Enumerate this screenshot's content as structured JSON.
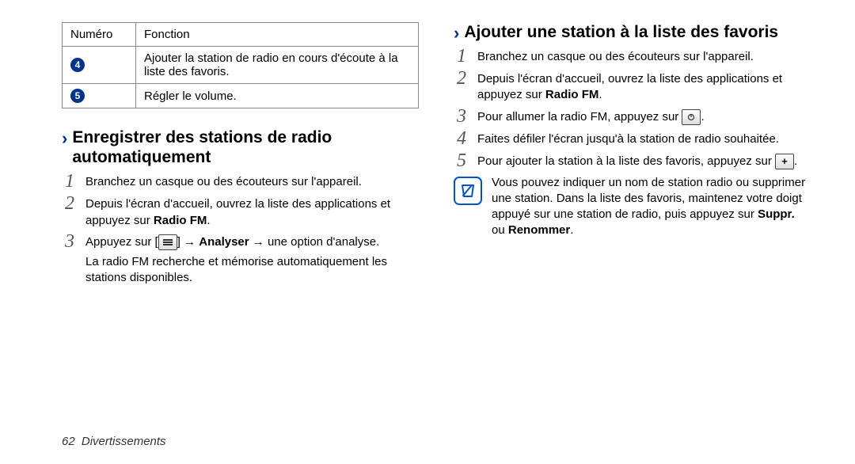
{
  "table": {
    "head_num": "Numéro",
    "head_fn": "Fonction",
    "rows": [
      {
        "n": "4",
        "fn": "Ajouter la station de radio en cours d'écoute à la liste des favoris."
      },
      {
        "n": "5",
        "fn": "Régler le volume."
      }
    ]
  },
  "left": {
    "title": "Enregistrer des stations de radio automatiquement",
    "steps": {
      "s1": "Branchez un casque ou des écouteurs sur l'appareil.",
      "s2_a": "Depuis l'écran d'accueil, ouvrez la liste des applications et appuyez sur ",
      "s2_b": "Radio FM",
      "s2_c": ".",
      "s3_a": "Appuyez sur [",
      "s3_b": "] → ",
      "s3_c": "Analyser",
      "s3_d": " → une option d'analyse.",
      "s3_sub": "La radio FM recherche et mémorise automatiquement les stations disponibles."
    }
  },
  "right": {
    "title": "Ajouter une station à la liste des favoris",
    "steps": {
      "s1": "Branchez un casque ou des écouteurs sur l'appareil.",
      "s2_a": "Depuis l'écran d'accueil, ouvrez la liste des applications et appuyez sur ",
      "s2_b": "Radio FM",
      "s2_c": ".",
      "s3_a": "Pour allumer la radio FM, appuyez sur ",
      "s3_b": ".",
      "s4": "Faites défiler l'écran jusqu'à la station de radio souhaitée.",
      "s5_a": "Pour ajouter la station à la liste des favoris, appuyez sur ",
      "s5_b": "."
    },
    "note": {
      "a": "Vous pouvez indiquer un nom de station radio ou supprimer une station. Dans la liste des favoris, maintenez votre doigt appuyé sur une station de radio, puis appuyez sur ",
      "b": "Suppr.",
      "c": " ou ",
      "d": "Renommer",
      "e": "."
    }
  },
  "footer": {
    "page": "62",
    "section": "Divertissements"
  },
  "icons": {
    "power_label": "Power"
  }
}
